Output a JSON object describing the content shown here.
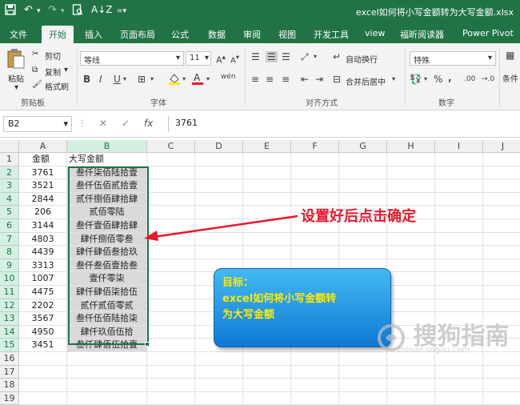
{
  "titlebar": {
    "file_title": "excel如何将小写金额转为大写金额.xlsx",
    "save_icon": "save-icon",
    "undo_icon": "undo-icon",
    "redo_icon": "redo-icon",
    "print_preview_icon": "print-preview-icon",
    "sort_icon": "sort-icon"
  },
  "tabs": [
    "文件",
    "开始",
    "插入",
    "页面布局",
    "公式",
    "数据",
    "审阅",
    "视图",
    "开发工具",
    "view",
    "福昕阅读器",
    "Power Pivot"
  ],
  "active_tab": "开始",
  "ribbon": {
    "paste": "粘贴",
    "cut": "剪切",
    "copy": "复制",
    "format_painter": "格式刷",
    "clipboard_group": "剪贴板",
    "font_name": "等线",
    "font_size": "11",
    "font_group": "字体",
    "bold": "B",
    "italic": "I",
    "underline": "U",
    "wen": "wén",
    "wrap_text": "自动换行",
    "merge_center": "合并后居中",
    "align_group": "对齐方式",
    "number_format": "特殊",
    "percent": "%",
    "comma": ",",
    "inc_decimal": ".00",
    "dec_decimal": "→.0",
    "number_group": "数字",
    "conditional": "条件"
  },
  "formula_bar": {
    "name_box": "B2",
    "fx": "fx",
    "cancel": "✕",
    "confirm": "✓",
    "content": "3761"
  },
  "sheet": {
    "columns": [
      "A",
      "B",
      "C",
      "D",
      "E",
      "F",
      "G",
      "H",
      "I",
      "J"
    ],
    "rows": [
      [
        "金额",
        "大写金额"
      ],
      [
        "3761",
        "叁仟柒佰陆拾壹"
      ],
      [
        "3521",
        "叁仟伍佰贰拾壹"
      ],
      [
        "2844",
        "贰仟捌佰肆拾肆"
      ],
      [
        "206",
        "贰佰零陆"
      ],
      [
        "3144",
        "叁仟壹佰肆拾肆"
      ],
      [
        "4803",
        "肆仟捌佰零叁"
      ],
      [
        "4439",
        "肆仟肆佰叁拾玖"
      ],
      [
        "3313",
        "叁仟叁佰壹拾叁"
      ],
      [
        "1007",
        "壹仟零柒"
      ],
      [
        "4475",
        "肆仟肆佰柒拾伍"
      ],
      [
        "2202",
        "贰仟贰佰零贰"
      ],
      [
        "3567",
        "叁仟伍佰陆拾柒"
      ],
      [
        "4950",
        "肆仟玖佰伍拾"
      ],
      [
        "3451",
        "叁仟肆佰伍拾壹"
      ],
      [
        "",
        ""
      ],
      [
        "",
        ""
      ],
      [
        "",
        ""
      ],
      [
        "",
        ""
      ]
    ]
  },
  "annotation": {
    "callout": "设置好后点击确定",
    "arrow_color": "#e8192c",
    "goal_line1": "目标：",
    "goal_line2": "excel如何将小写金额转",
    "goal_line3": "为大写金额"
  },
  "watermark": {
    "text": "搜狗指南",
    "sub": "zhinan.sogou.com"
  },
  "colors": {
    "brand": "#217346",
    "callout_red": "#e8192c",
    "goal_text": "#ffea00",
    "goal_bg": "#1a8fe0"
  }
}
